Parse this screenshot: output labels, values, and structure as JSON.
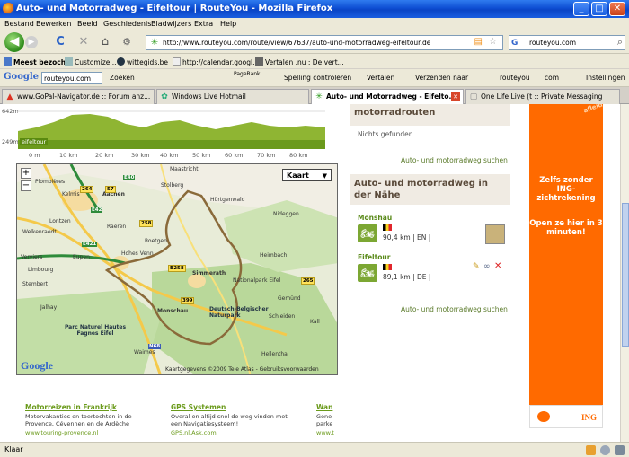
{
  "window": {
    "title": "Auto- und Motorradweg - Eifeltour | RouteYou - Mozilla Firefox",
    "min": "_",
    "max": "□",
    "close": "✕"
  },
  "menu": [
    "Bestand",
    "Bewerken",
    "Beeld",
    "Geschiedenis",
    "Bladwijzers",
    "Extra",
    "Help"
  ],
  "nav": {
    "back": "◀",
    "forward": "▶",
    "reload": "C",
    "stop": "✕",
    "home": "⌂",
    "url": "http://www.routeyou.com/route/view/67637/auto-und-motorradweg-eifeltour.de",
    "search_engine": "G",
    "search_value": "routeyou.com"
  },
  "bookmarks": [
    "Meest bezocht",
    "Customize...",
    "wittegids.be",
    "http://calendar.googl...",
    "Vertalen .nu : De vert..."
  ],
  "google_toolbar": {
    "logo": "Google",
    "search_value": "routeyou.com",
    "items": [
      "Zoeken",
      "PageRank",
      "Spelling controleren",
      "Vertalen",
      "Verzenden naar",
      "routeyou",
      "com",
      "Instellingen"
    ]
  },
  "tabs": [
    {
      "label": "www.GoPal-Navigator.de :: Forum anz...",
      "active": false
    },
    {
      "label": "Windows Live Hotmail",
      "active": false
    },
    {
      "label": "Auto- und Motorradweg - Eifelto...",
      "active": true
    },
    {
      "label": "One Life Live (t :: Private Messaging",
      "active": false
    }
  ],
  "profile": {
    "elev_top": "642m",
    "elev_bottom": "249m",
    "marker": "eifeltour",
    "km_labels": [
      "0 m",
      "10 km",
      "20 km",
      "30 km",
      "40 km",
      "50 km",
      "60 km",
      "70 km",
      "80 km"
    ]
  },
  "map": {
    "type_label": "Kaart",
    "zoom_in": "+",
    "zoom_out": "−",
    "copyright": "Kaartgegevens ©2009 Tele Atlas - Gebruiksvoorwaarden",
    "logo": "Google",
    "places": [
      "Plombières",
      "Maastricht",
      "Aachen",
      "Kelmis",
      "Eupen",
      "Raeren",
      "Welkenraedt",
      "Limbourg",
      "Verviers",
      "Stembert",
      "Jalhay",
      "Roetgen",
      "Hürtgenwald",
      "Nideggen",
      "Simmerath",
      "Monschau",
      "Heimbach",
      "Nationalpark Eifel",
      "Deutsch-Belgischer Naturpark",
      "Parc Naturel Hautes Fagnes Eifel",
      "Schleiden",
      "Hellenthal",
      "Gemünd",
      "Kall",
      "Waimes",
      "Lontzen",
      "Hohes Venn",
      "Stolberg"
    ],
    "roads": [
      {
        "t": "E40",
        "c": "g"
      },
      {
        "t": "E42",
        "c": "g"
      },
      {
        "t": "E421",
        "c": "g"
      },
      {
        "t": "258",
        "c": "y"
      },
      {
        "t": "264",
        "c": "y"
      },
      {
        "t": "57",
        "c": "y"
      },
      {
        "t": "399",
        "c": "y"
      },
      {
        "t": "265",
        "c": "y"
      },
      {
        "t": "N68",
        "c": "b"
      },
      {
        "t": "B258",
        "c": "y"
      }
    ]
  },
  "right": {
    "box1_title": "motorradrouten",
    "none_found": "Nichts gefunden",
    "search_link1": "Auto- und motorradweg suchen",
    "box2_title": "Auto- und motorradweg in der Nähe",
    "routes": [
      {
        "name": "Monshau",
        "km": "90,4 km",
        "lang": "EN"
      },
      {
        "name": "Eifeltour",
        "km": "89,1 km",
        "lang": "DE"
      }
    ],
    "search_link2": "Auto- und motorradweg suchen"
  },
  "ad": {
    "ribbon": "afleid",
    "line1": "Zelfs zonder ING-zichtrekening",
    "line2": "Open ze hier in 3 minuten!",
    "brand": "ING"
  },
  "bottom_ads": [
    {
      "title": "Motorreizen in Frankrijk",
      "text": "Motorvakanties en toertochten in de Provence, Cévennen en de Ardèche",
      "url": "www.touring-provence.nl"
    },
    {
      "title": "GPS Systemen",
      "text": "Overal en altijd snel de weg vinden met een Navigatiesysteem!",
      "url": "GPS.nl.Ask.com"
    },
    {
      "title": "Wan",
      "text": "Gene parke",
      "url": "www.t"
    }
  ],
  "status": {
    "text": "Klaar"
  }
}
